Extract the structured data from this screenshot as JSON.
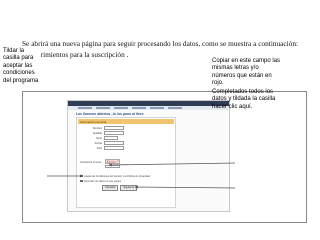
{
  "intro": {
    "text": "Se abrirá una nueva página para seguir procesando los datos, como se muestra a continuación: Requerimientos para la suscripción ."
  },
  "screenshot": {
    "page_title": "Los llorones abiertos ..lo los puno al lleve",
    "panel_label": "Información personal",
    "fields": [
      {
        "label": "Nombre"
      },
      {
        "label": "Apellido"
      },
      {
        "label": "Sexo"
      },
      {
        "label": "Fecha"
      },
      {
        "label": "País"
      }
    ],
    "captcha_label": "Introduzca el texto",
    "captcha_text": "Xy%c7",
    "terms_check": "Acepto las Condiciones del Servicio y la Política de privacidad",
    "terms_link": "Condiciones del Servicio",
    "remember_check": "Recordar mis datos en este equipo",
    "buttons": [
      "Cancelar",
      "Siguiente"
    ]
  },
  "callouts": {
    "left": "Tildar la casilla para aceptar las condiciones del programa",
    "right_top": "Copiar en este campo las mismas letras y/o números que están en rojo.",
    "right_bottom": "Completados todos los datos y tildada la casilla hacer clic aquí."
  },
  "colors": {
    "arrow": "#555555",
    "captcha": "#d22020",
    "panel": "#f2c46d"
  }
}
